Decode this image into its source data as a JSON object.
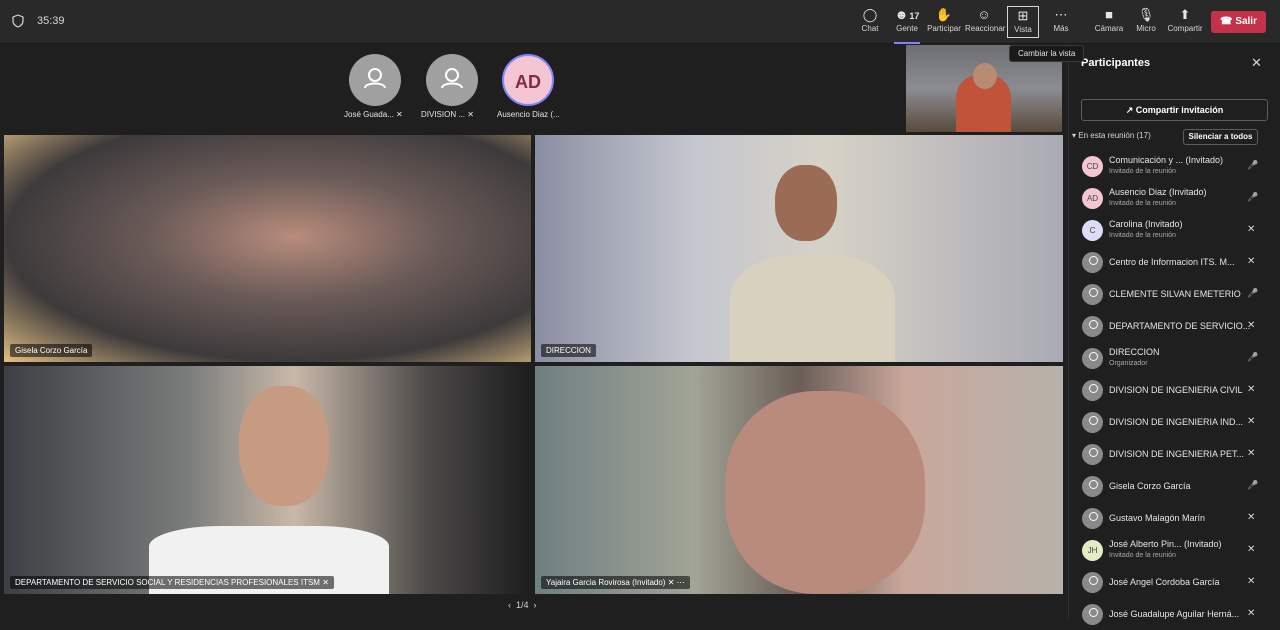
{
  "topbar": {
    "timer": "35:39",
    "chat": "Chat",
    "people": "Gente",
    "people_count": "17",
    "raise": "Participar",
    "react": "Reaccionar",
    "view": "Vista",
    "more": "Más",
    "camera": "Cámara",
    "mic": "Micro",
    "share": "Compartir",
    "leave": "Salir",
    "tooltip": "Cambiar la vista"
  },
  "roster": [
    {
      "name": "José Guada..."
    },
    {
      "name": "DIVISION ..."
    },
    {
      "name": "Ausencio Diaz (...",
      "initials": "AD"
    }
  ],
  "tiles": [
    {
      "name": "Gisela Corzo García"
    },
    {
      "name": "DIRECCION"
    },
    {
      "name": "DEPARTAMENTO DE SERVICIO SOCIAL Y RESIDENCIAS PROFESIONALES ITSM"
    },
    {
      "name": "Yajaira Garcia Rovirosa (Invitado)"
    }
  ],
  "pager": "1/4",
  "panel": {
    "title": "Participantes",
    "share_invite": "Compartir invitación",
    "section": "En esta reunión (17)",
    "mute_all": "Silenciar a todos",
    "participants": [
      {
        "initials": "CD",
        "name": "Comunicación y ... (Invitado)",
        "sub": "Invitado de la reunión",
        "mic": "on",
        "color": "#f4c6d1"
      },
      {
        "initials": "AD",
        "name": "Ausencio Diaz (Invitado)",
        "sub": "Invitado de la reunión",
        "mic": "on",
        "color": "#f4c6d1"
      },
      {
        "initials": "C",
        "name": "Carolina (Invitado)",
        "sub": "Invitado de la reunión",
        "mic": "off",
        "color": "#dcdcf7"
      },
      {
        "initials": "",
        "name": "Centro de Informacion ITS. M...",
        "sub": "",
        "mic": "off",
        "color": "#8a8a8a"
      },
      {
        "initials": "",
        "name": "CLEMENTE SILVAN EMETERIO",
        "sub": "",
        "mic": "on",
        "color": "#8a8a8a"
      },
      {
        "initials": "",
        "name": "DEPARTAMENTO DE SERVICIO...",
        "sub": "",
        "mic": "off",
        "color": "#8a8a8a"
      },
      {
        "initials": "",
        "name": "DIRECCION",
        "sub": "Organizador",
        "mic": "on",
        "color": "#8a8a8a"
      },
      {
        "initials": "",
        "name": "DIVISION DE INGENIERIA CIVIL",
        "sub": "",
        "mic": "off",
        "color": "#8a8a8a"
      },
      {
        "initials": "",
        "name": "DIVISION DE INGENIERIA IND...",
        "sub": "",
        "mic": "off",
        "color": "#8a8a8a"
      },
      {
        "initials": "",
        "name": "DIVISION DE INGENIERIA PET...",
        "sub": "",
        "mic": "off",
        "color": "#8a8a8a"
      },
      {
        "initials": "",
        "name": "Gisela Corzo García",
        "sub": "",
        "mic": "on",
        "color": "#8a8a8a"
      },
      {
        "initials": "",
        "name": "Gustavo Malagón Marín",
        "sub": "",
        "mic": "off",
        "color": "#8a8a8a"
      },
      {
        "initials": "JH",
        "name": "José Alberto Pin... (Invitado)",
        "sub": "Invitado de la reunión",
        "mic": "off",
        "color": "#e3ecc4"
      },
      {
        "initials": "",
        "name": "José Angel Cordoba García",
        "sub": "",
        "mic": "off",
        "color": "#8a8a8a"
      },
      {
        "initials": "",
        "name": "José Guadalupe Aguilar Herná...",
        "sub": "",
        "mic": "off",
        "color": "#8a8a8a"
      }
    ]
  }
}
